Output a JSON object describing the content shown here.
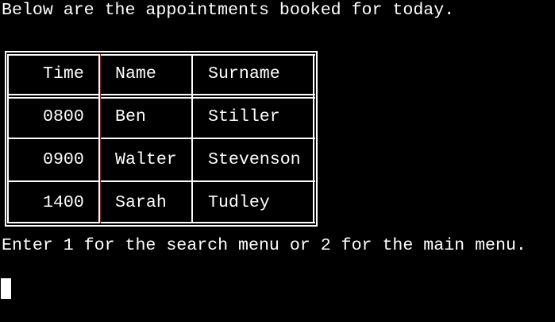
{
  "terminal": {
    "intro": "Below are the appointments booked for today.",
    "prompt": "Enter 1 for the search menu or 2 for the main menu."
  },
  "table": {
    "headers": [
      "Time",
      "Name",
      "Surname"
    ],
    "rows": [
      [
        "0800",
        "Ben",
        "Stiller"
      ],
      [
        "0900",
        "Walter",
        "Stevenson"
      ],
      [
        "1400",
        "Sarah",
        "Tudley"
      ]
    ]
  },
  "colors": {
    "background": "#000000",
    "text": "#ffffff",
    "border": "#ffffff"
  }
}
